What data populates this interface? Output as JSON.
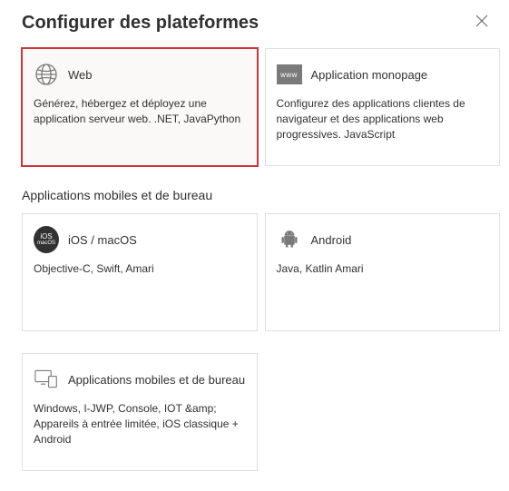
{
  "header": {
    "title": "Configurer des plateformes"
  },
  "cards_top": [
    {
      "name": "web-platform-card",
      "icon": "globe-icon",
      "title": "Web",
      "desc": "Générez, hébergez et déployez une application serveur web. .NET, JavaPython",
      "highlight": true
    },
    {
      "name": "spa-platform-card",
      "icon": "www-icon",
      "title": "Application monopage",
      "desc": "Configurez des applications clientes de navigateur et des applications web progressives. JavaScript",
      "highlight": false
    }
  ],
  "section2": {
    "title": "Applications mobiles et de bureau"
  },
  "cards_mobile": [
    {
      "name": "ios-macos-card",
      "icon": "ios-icon",
      "title": "iOS / macOS",
      "desc": "Objective-C, Swift, Amari"
    },
    {
      "name": "android-card",
      "icon": "android-icon",
      "title": "Android",
      "desc": "Java, Katlin Amari"
    }
  ],
  "cards_desktop": [
    {
      "name": "mobile-desktop-card",
      "icon": "monitor-icon",
      "title": "Applications mobiles et de bureau",
      "desc": "Windows, I-JWP, Console, IOT &amp; Appareils à entrée limitée, iOS classique + Android"
    }
  ]
}
